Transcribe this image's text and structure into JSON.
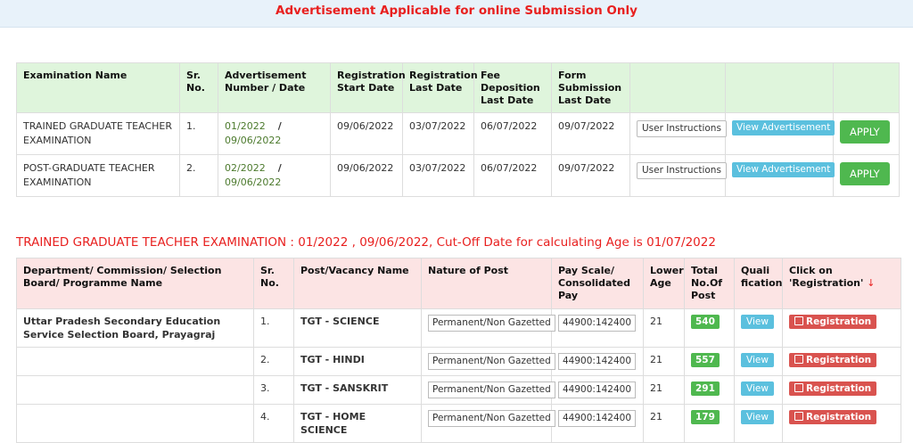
{
  "banner": {
    "text": "Advertisement Applicable for online Submission Only"
  },
  "adv_table": {
    "headers": {
      "exam_name": "Examination Name",
      "sr_no": "Sr. No.",
      "adv_no_date": "Advertisement Number / Date",
      "reg_start": "Registration Start Date",
      "reg_last": "Registration Last Date",
      "fee_last": "Fee Deposition Last Date",
      "form_last": "Form Submission Last Date"
    },
    "rows": [
      {
        "exam_name": "TRAINED GRADUATE TEACHER EXAMINATION",
        "sr": "1.",
        "adv_no": "01/2022",
        "adv_date": "09/06/2022",
        "reg_start": "09/06/2022",
        "reg_last": "03/07/2022",
        "fee_last": "06/07/2022",
        "form_last": "09/07/2022",
        "instructions_label": "User Instructions",
        "view_label": "View Advertisement",
        "apply_label": "APPLY"
      },
      {
        "exam_name": "POST-GRADUATE TEACHER EXAMINATION",
        "sr": "2.",
        "adv_no": "02/2022",
        "adv_date": "09/06/2022",
        "reg_start": "09/06/2022",
        "reg_last": "03/07/2022",
        "fee_last": "06/07/2022",
        "form_last": "09/07/2022",
        "instructions_label": "User Instructions",
        "view_label": "View Advertisement",
        "apply_label": "APPLY"
      }
    ],
    "separator": "/"
  },
  "section_title": "TRAINED GRADUATE TEACHER EXAMINATION : 01/2022 , 09/06/2022, Cut-Off Date for calculating Age is 01/07/2022",
  "vac_table": {
    "headers": {
      "dept": "Department/ Commission/ Selection Board/ Programme Name",
      "sr_no": "Sr. No.",
      "post_name": "Post/Vacancy Name",
      "nature": "Nature of Post",
      "pay_scale": "Pay Scale/ Consolidated Pay",
      "lower_age": "Lower Age",
      "total_posts": "Total No.Of Post",
      "qualification": "Quali fication",
      "click_reg": "Click on 'Registration'",
      "click_reg_arrow": "↓"
    },
    "rows": [
      {
        "dept": "Uttar Pradesh Secondary Education Service Selection Board, Prayagraj",
        "sr": "1.",
        "post": "TGT - SCIENCE",
        "nature": "Permanent/Non Gazetted",
        "pay": "44900:142400",
        "age": "21",
        "posts": "540",
        "view_label": "View",
        "reg_label": "Registration"
      },
      {
        "dept": "",
        "sr": "2.",
        "post": "TGT - HINDI",
        "nature": "Permanent/Non Gazetted",
        "pay": "44900:142400",
        "age": "21",
        "posts": "557",
        "view_label": "View",
        "reg_label": "Registration"
      },
      {
        "dept": "",
        "sr": "3.",
        "post": "TGT - SANSKRIT",
        "nature": "Permanent/Non Gazetted",
        "pay": "44900:142400",
        "age": "21",
        "posts": "291",
        "view_label": "View",
        "reg_label": "Registration"
      },
      {
        "dept": "",
        "sr": "4.",
        "post": "TGT - HOME SCIENCE",
        "nature": "Permanent/Non Gazetted",
        "pay": "44900:142400",
        "age": "21",
        "posts": "179",
        "view_label": "View",
        "reg_label": "Registration"
      }
    ],
    "reg_icon": "edit-icon"
  }
}
